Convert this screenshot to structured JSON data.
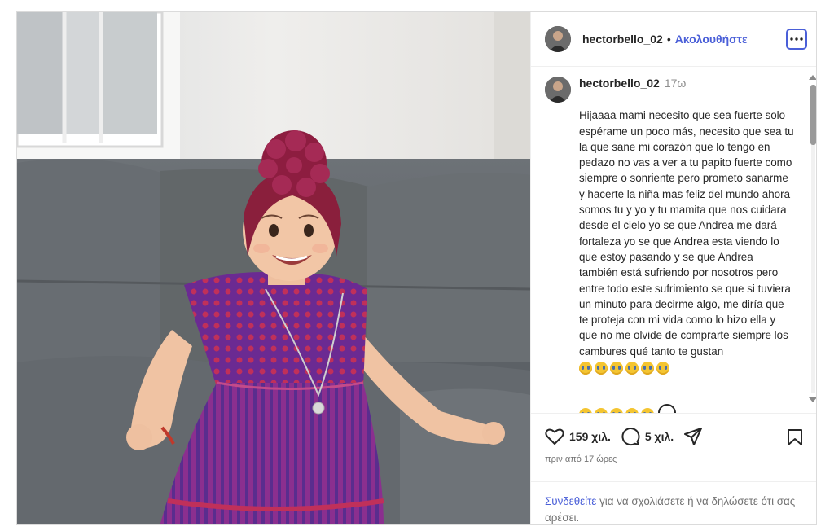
{
  "post": {
    "username": "hectorbello_02",
    "separator": "•",
    "follow_label": "Ακολουθήστε",
    "more_label": "···",
    "caption_username": "hectorbello_02",
    "caption_time": "17ω",
    "caption_text": "Hijaaaa mami necesito que sea fuerte solo espérame un poco más, necesito que sea tu la que sane mi corazón que lo tengo en pedazo no vas a ver a tu papito fuerte como siempre o sonriente pero prometo sanarme y hacerte la niña mas feliz del mundo ahora somos tu y yo y tu mamita que nos cuidara desde el cielo yo se que Andrea me dará fortaleza yo se que Andrea esta viendo lo que estoy pasando y se que Andrea también está sufriendo por nosotros pero entre todo este sufrimiento se que si tuviera un minuto para decirme algo, me diría que te proteja con mi vida como lo hizo ella y que no me olvide de comprarte siempre los cambures qué tanto te gustan",
    "caption_emoji_row1": 6,
    "caption_emoji_row2": 5,
    "emoji_name": "crying-face-emoji",
    "likes": "159 χιλ.",
    "comments_count": "5 χιλ.",
    "time_ago": "πριν από 17 ώρες",
    "login_link": "Συνδεθείτε",
    "login_text": " για να σχολιάσετε ή να δηλώσετε ότι σας αρέσει."
  },
  "colors": {
    "accent": "#4a5fd8",
    "muted": "#737373",
    "dress_purple": "#7a2a8a",
    "headband": "#8a1f3c"
  }
}
